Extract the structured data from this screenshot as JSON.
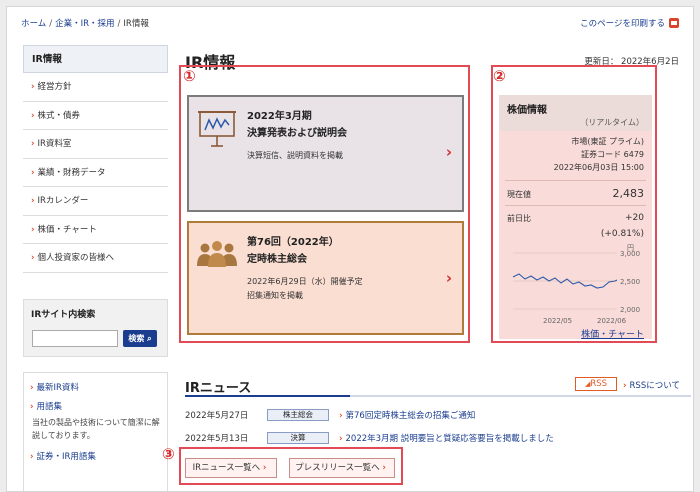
{
  "breadcrumb": [
    "ホーム",
    "企業・IR・採用",
    "IR情報"
  ],
  "print_label": "このページを印刷する",
  "sidebar": {
    "header": "IR情報",
    "items": [
      "経営方針",
      "株式・債券",
      "IR資料室",
      "業績・財務データ",
      "IRカレンダー",
      "株価・チャート",
      "個人投資家の皆様へ"
    ],
    "search_title": "IRサイト内検索",
    "search_button": "検索",
    "links": [
      {
        "label": "最新IR資料",
        "desc": ""
      },
      {
        "label": "用語集",
        "desc": "当社の製品や技術について簡潔に解説しております。"
      },
      {
        "label": "証券・IR用語集",
        "desc": ""
      }
    ]
  },
  "main": {
    "title": "IR情報",
    "updated": "更新日：  2022年6月2日",
    "markers": [
      "①",
      "②",
      "③"
    ],
    "card1": {
      "title1": "2022年3月期",
      "title2": "決算発表および説明会",
      "sub": "決算短信、説明資料を掲載"
    },
    "card2": {
      "title1": "第76回（2022年）",
      "title2": "定時株主総会",
      "sub1": "2022年6月29日（水）開催予定",
      "sub2": "招集通知を掲載"
    }
  },
  "stock": {
    "title": "株価情報",
    "realtime": "（リアルタイム）",
    "market": "市場(東証 プライム)",
    "code": "証券コード 6479",
    "datetime": "2022年06月03日 15:00",
    "price_label": "現在値",
    "price": "2,483",
    "change_label": "前日比",
    "change": "+20",
    "change_pct": "(+0.81%)",
    "chart_unit": "円",
    "chart_yticks": [
      "3,000",
      "2,500",
      "2,000"
    ],
    "chart_xticks": [
      "2022/05",
      "2022/06"
    ],
    "link": "株価・チャート",
    "line_color": "#2c5aa8"
  },
  "news": {
    "title": "IRニュース",
    "rss": "RSS",
    "rss_about": "RSSについて",
    "items": [
      {
        "date": "2022年5月27日",
        "tag": "株主総会",
        "title": "第76回定時株主総会の招集ご通知"
      },
      {
        "date": "2022年5月13日",
        "tag": "決算",
        "title": "2022年3月期 説明要旨と質疑応答要旨を掲載しました"
      }
    ],
    "btn_list": "IRニュース一覧へ",
    "btn_press": "プレスリリース一覧へ"
  }
}
